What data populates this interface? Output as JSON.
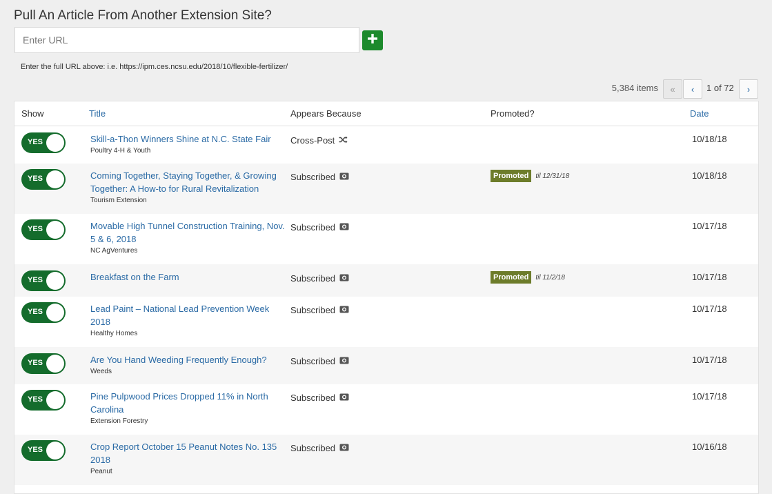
{
  "pull": {
    "heading": "Pull An Article From Another Extension Site?",
    "url_placeholder": "Enter URL",
    "url_value": "",
    "hint": "Enter the full URL above: i.e. https://ipm.ces.ncsu.edu/2018/10/flexible-fertilizer/",
    "add_icon": "plus-icon",
    "accent": "#1d8a2c"
  },
  "pagination": {
    "items_count": "5,384 items",
    "first_label": "«",
    "prev_label": "‹",
    "page_info": "1 of 72",
    "next_label": "›"
  },
  "table": {
    "headers": {
      "show": "Show",
      "title": "Title",
      "appears": "Appears Because",
      "promoted": "Promoted?",
      "date": "Date"
    },
    "toggle_label": "YES",
    "toggle_color": "#146c2c",
    "promoted_color": "#6d7c2a",
    "rows": [
      {
        "title": "Skill-a-Thon Winners Shine at N.C. State Fair",
        "source": "Poultry 4-H & Youth",
        "reason": "Cross-Post",
        "reason_icon": "shuffle-icon",
        "promoted": "",
        "promoted_until": "",
        "date": "10/18/18"
      },
      {
        "title": "Coming Together, Staying Together, & Growing Together: A How-to for Rural Revitalization",
        "source": "Tourism Extension",
        "reason": "Subscribed",
        "reason_icon": "subscribed-icon",
        "promoted": "Promoted",
        "promoted_until": "til 12/31/18",
        "date": "10/18/18"
      },
      {
        "title": "Movable High Tunnel Construction Training, Nov. 5 & 6, 2018",
        "source": "NC AgVentures",
        "reason": "Subscribed",
        "reason_icon": "subscribed-icon",
        "promoted": "",
        "promoted_until": "",
        "date": "10/17/18"
      },
      {
        "title": "Breakfast on the Farm",
        "source": "",
        "reason": "Subscribed",
        "reason_icon": "subscribed-icon",
        "promoted": "Promoted",
        "promoted_until": "til 11/2/18",
        "date": "10/17/18"
      },
      {
        "title": "Lead Paint – National Lead Prevention Week 2018",
        "source": "Healthy Homes",
        "reason": "Subscribed",
        "reason_icon": "subscribed-icon",
        "promoted": "",
        "promoted_until": "",
        "date": "10/17/18"
      },
      {
        "title": "Are You Hand Weeding Frequently Enough?",
        "source": "Weeds",
        "reason": "Subscribed",
        "reason_icon": "subscribed-icon",
        "promoted": "",
        "promoted_until": "",
        "date": "10/17/18"
      },
      {
        "title": "Pine Pulpwood Prices Dropped 11% in North Carolina",
        "source": "Extension Forestry",
        "reason": "Subscribed",
        "reason_icon": "subscribed-icon",
        "promoted": "",
        "promoted_until": "",
        "date": "10/17/18"
      },
      {
        "title": "Crop Report October 15 Peanut Notes No. 135 2018",
        "source": "Peanut",
        "reason": "Subscribed",
        "reason_icon": "subscribed-icon",
        "promoted": "",
        "promoted_until": "",
        "date": "10/16/18"
      }
    ]
  }
}
